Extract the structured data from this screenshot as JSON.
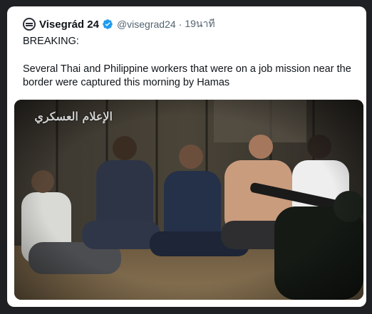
{
  "tweet": {
    "author_name": "Visegrád 24",
    "handle": "@visegrad24",
    "separator": "·",
    "time": "19นาที",
    "paragraph_1": "BREAKING:",
    "paragraph_2": "Several Thai and Philippine workers that were on a job mission near the border were captured this morning by Hamas",
    "media_watermark": "الإعلام العسكري"
  },
  "colors": {
    "verified_badge": "#1d9bf0",
    "text_primary": "#0f1419",
    "text_secondary": "#536471"
  },
  "icons": {
    "avatar": "visegrad-logo-icon",
    "verified": "verified-badge-icon"
  }
}
